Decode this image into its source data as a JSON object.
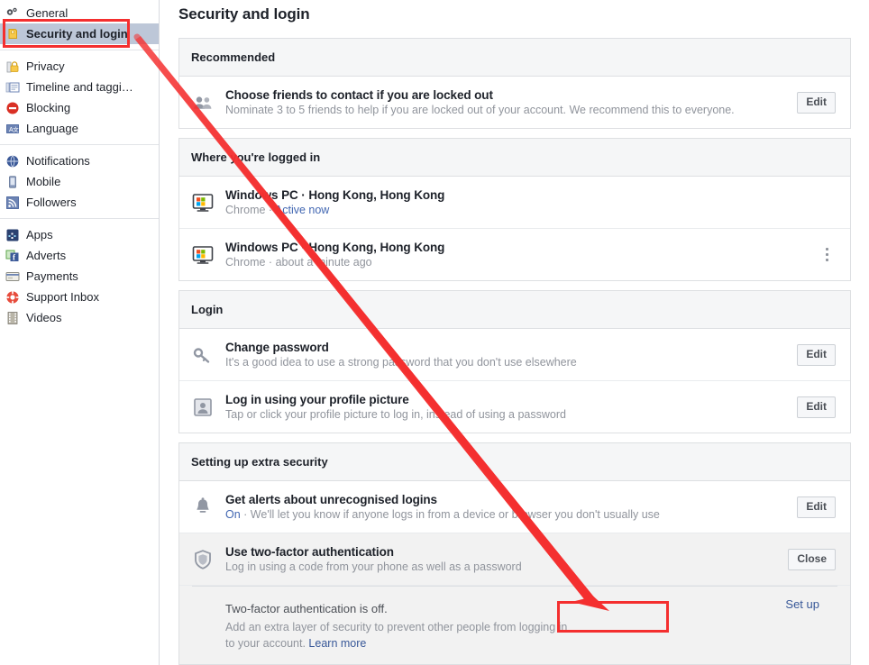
{
  "sidebar": {
    "groups": [
      {
        "items": [
          {
            "label": "General",
            "icon": "gears-icon",
            "selected": false
          },
          {
            "label": "Security and login",
            "icon": "shield-icon",
            "selected": true
          }
        ]
      },
      {
        "items": [
          {
            "label": "Privacy",
            "icon": "padlock-icon",
            "selected": false
          },
          {
            "label": "Timeline and taggi…",
            "icon": "timeline-icon",
            "selected": false
          },
          {
            "label": "Blocking",
            "icon": "block-icon",
            "selected": false
          },
          {
            "label": "Language",
            "icon": "language-icon",
            "selected": false
          }
        ]
      },
      {
        "items": [
          {
            "label": "Notifications",
            "icon": "globe-icon",
            "selected": false
          },
          {
            "label": "Mobile",
            "icon": "mobile-icon",
            "selected": false
          },
          {
            "label": "Followers",
            "icon": "rss-icon",
            "selected": false
          }
        ]
      },
      {
        "items": [
          {
            "label": "Apps",
            "icon": "apps-icon",
            "selected": false
          },
          {
            "label": "Adverts",
            "icon": "adverts-icon",
            "selected": false
          },
          {
            "label": "Payments",
            "icon": "payments-icon",
            "selected": false
          },
          {
            "label": "Support Inbox",
            "icon": "lifebuoy-icon",
            "selected": false
          },
          {
            "label": "Videos",
            "icon": "film-icon",
            "selected": false
          }
        ]
      }
    ]
  },
  "main": {
    "page_title": "Security and login",
    "sections": [
      {
        "header": "Recommended",
        "rows": [
          {
            "icon": "friends-icon",
            "title": "Choose friends to contact if you are locked out",
            "sub": "Nominate 3 to 5 friends to help if you are locked out of your account. We recommend this to everyone.",
            "action": "Edit"
          }
        ]
      },
      {
        "header": "Where you're logged in",
        "rows": [
          {
            "icon": "windows-pc-icon",
            "title": "Windows PC · Hong Kong, Hong Kong",
            "sub_prefix": "Chrome · ",
            "sub_link": "Active now",
            "action": ""
          },
          {
            "icon": "windows-pc-icon",
            "title": "Windows PC · Hong Kong, Hong Kong",
            "sub_prefix": "Chrome · about a minute ago",
            "sub_link": "",
            "action": "kebab"
          }
        ]
      },
      {
        "header": "Login",
        "rows": [
          {
            "icon": "key-icon",
            "title": "Change password",
            "sub": "It's a good idea to use a strong password that you don't use elsewhere",
            "action": "Edit"
          },
          {
            "icon": "profile-picture-icon",
            "title": "Log in using your profile picture",
            "sub": "Tap or click your profile picture to log in, instead of using a password",
            "action": "Edit"
          }
        ]
      },
      {
        "header": "Setting up extra security",
        "rows": [
          {
            "icon": "bell-icon",
            "title": "Get alerts about unrecognised logins",
            "sub_status": "On",
            "sub_rest": " · We'll let you know if anyone logs in from a device or browser you don't usually use",
            "action": "Edit"
          },
          {
            "icon": "shield-outline-icon",
            "title": "Use two-factor authentication",
            "sub": "Log in using a code from your phone as well as a password",
            "action": "Close"
          }
        ],
        "two_factor_detail": {
          "status_line": "Two-factor authentication is off.",
          "description": "Add an extra layer of security to prevent other people from logging in to your account. ",
          "learn_more": "Learn more",
          "setup_link": "Set up"
        }
      }
    ]
  },
  "annotations": {
    "highlight_color": "#f42f2f",
    "boxes": [
      "security-and-login-sidebar-item",
      "set-up-link"
    ],
    "arrow": "points from Security and login sidebar item to the Set up link"
  }
}
